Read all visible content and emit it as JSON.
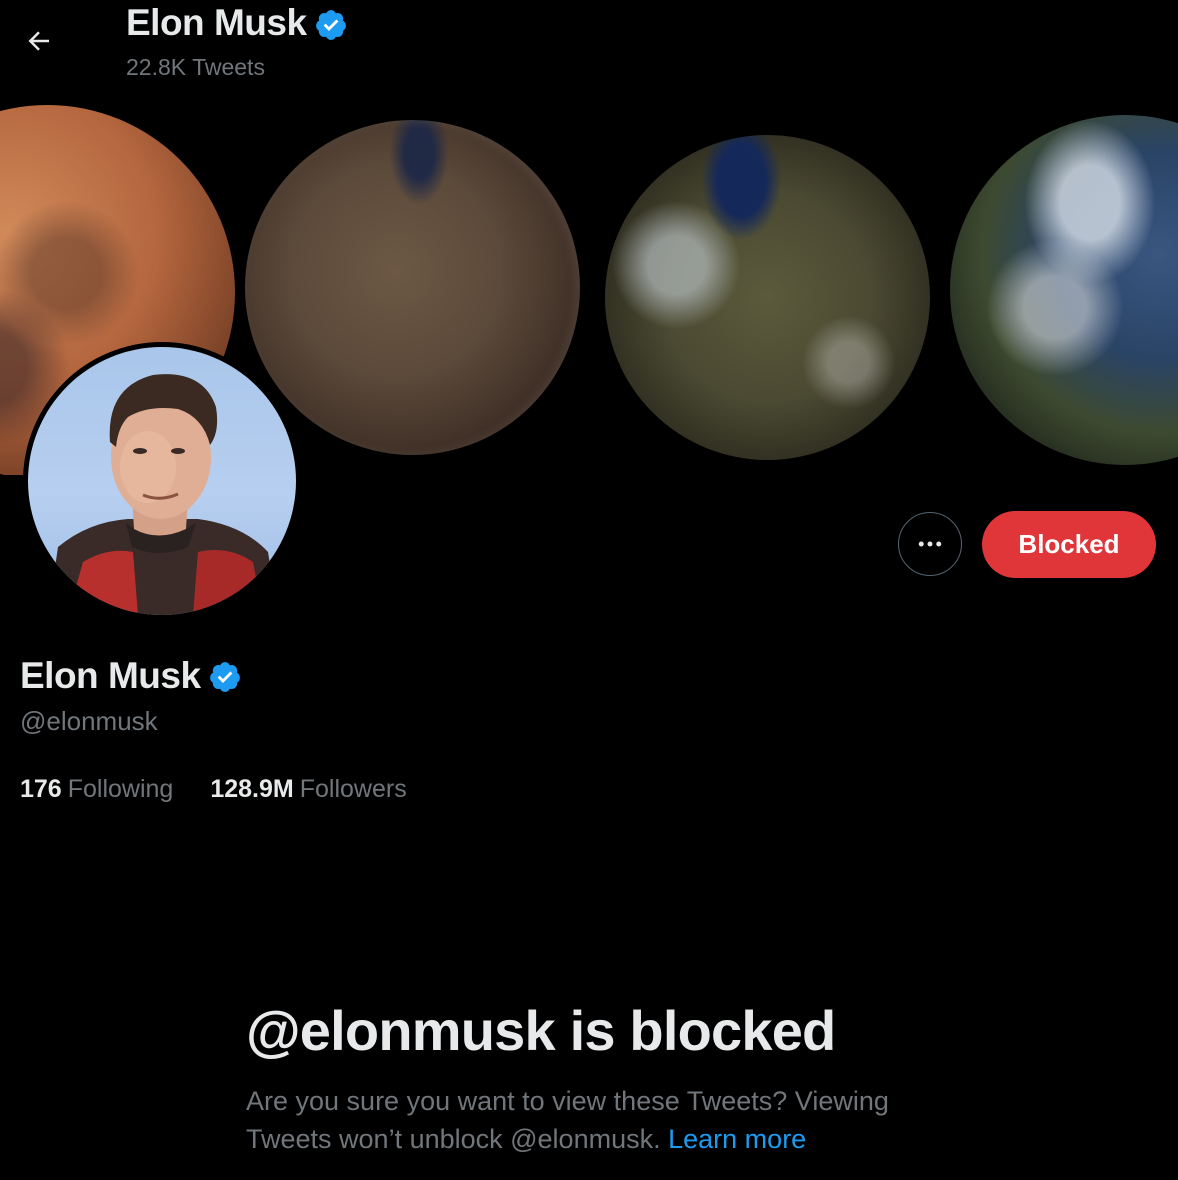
{
  "header": {
    "name": "Elon Musk",
    "tweet_count": "22.8K Tweets",
    "back_icon": "arrow-left-icon",
    "verified_icon": "verified-badge-icon"
  },
  "banner": {
    "planets": [
      "mars",
      "mars-with-water",
      "terraforming-mars",
      "earth-like-mars"
    ]
  },
  "profile": {
    "name": "Elon Musk",
    "handle": "@elonmusk",
    "following_count": "176",
    "following_label": "Following",
    "followers_count": "128.9M",
    "followers_label": "Followers"
  },
  "actions": {
    "more_icon": "more-horizontal-icon",
    "blocked_label": "Blocked"
  },
  "blocked_notice": {
    "title": "@elonmusk is blocked",
    "description": "Are you sure you want to view these Tweets? Viewing Tweets won’t unblock @elonmusk.",
    "learn_more": "Learn more"
  },
  "colors": {
    "background": "#000000",
    "primary_text": "#e7e9ea",
    "secondary_text": "#71767b",
    "blocked_red": "#e0363a",
    "link_blue": "#1d9bf0",
    "verified_blue": "#1d9bf0"
  }
}
